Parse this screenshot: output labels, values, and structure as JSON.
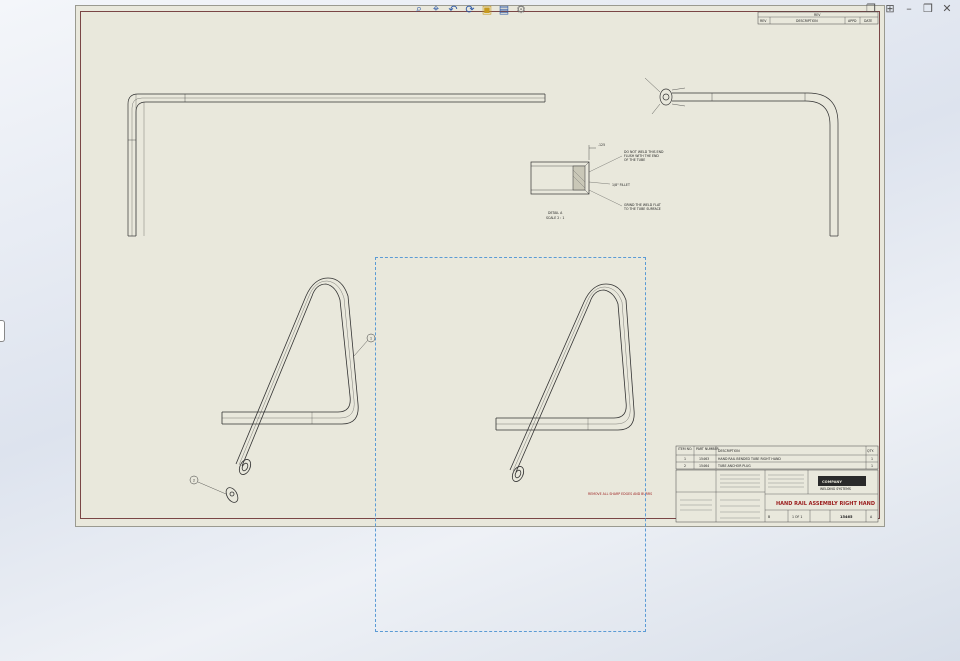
{
  "toolbar": {
    "buttons": [
      "zoom-to-fit-icon",
      "zoom-to-area-icon",
      "previous-view-icon",
      "rebuild-icon",
      "section-view-icon",
      "view-orientation-icon",
      "display-style-icon"
    ]
  },
  "window_controls": [
    "restore-icon",
    "tile-icon",
    "minimize-icon",
    "maximize-icon",
    "close-icon"
  ],
  "revision_block": {
    "header": "REV",
    "columns": [
      "REV",
      "DESCRIPTION",
      "APPD",
      "DATE"
    ]
  },
  "detail_view": {
    "label": "DETAIL A",
    "scale": "SCALE 2 : 1",
    "notes": [
      "DO NOT WELD THIS END",
      "FLUSH WITH THE END",
      "OF THE TUBE",
      "1/8\" FILLET",
      "GRIND THE WELD FLAT",
      "TO THE TUBE SURFACE"
    ]
  },
  "balloons": [
    "1",
    "2"
  ],
  "note_red": "REMOVE ALL SHARP EDGES AND BURRS",
  "bom": {
    "headers": [
      "ITEM NO.",
      "PART NUMBER",
      "DESCRIPTION",
      "QTY."
    ],
    "rows": [
      [
        "1",
        "15463",
        "HAND RAIL BENDED TUBE RIGHT HAND",
        "1"
      ],
      [
        "2",
        "15464",
        "TUBE ANCHOR PLUG",
        "1"
      ]
    ]
  },
  "title_block": {
    "title": "HAND RAIL ASSEMBLY RIGHT HAND",
    "part_no": "15465",
    "size": "B",
    "sheet": "1 OF 1",
    "company": "COMPANY",
    "company_sub": "WELDING SYSTEMS",
    "rev": "A"
  },
  "colors": {
    "sheet_bg": "#e9e8dc",
    "frame": "#7a4646",
    "selection": "#5b9bd5",
    "accent_red": "#9a1b1b"
  }
}
